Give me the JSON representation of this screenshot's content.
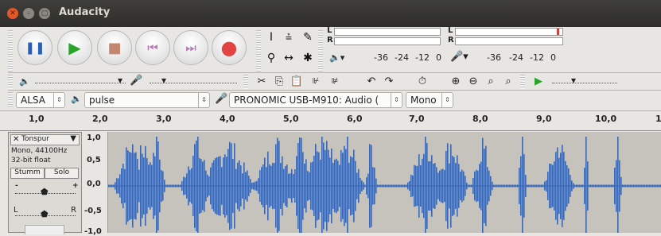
{
  "window": {
    "title": "Audacity"
  },
  "transport": {
    "buttons": [
      "pause",
      "play",
      "stop",
      "skip-start",
      "skip-end",
      "record"
    ]
  },
  "meters": {
    "ticks": [
      "-36",
      "-24",
      "-12",
      "0"
    ],
    "channels": [
      "L",
      "R"
    ]
  },
  "device": {
    "host": "ALSA",
    "output": "pulse",
    "input": "PRONOMIC USB-M910: Audio (",
    "channels": "Mono"
  },
  "ruler": {
    "ticks": [
      "1,0",
      "2,0",
      "3,0",
      "4,0",
      "5,0",
      "6,0",
      "7,0",
      "8,0",
      "9,0",
      "10,0",
      "1"
    ]
  },
  "track": {
    "name": "Tonspur",
    "info1": "Mono, 44100Hz",
    "info2": "32-bit float",
    "mute": "Stumm",
    "solo": "Solo",
    "pan_l": "L",
    "pan_r": "R",
    "gain_minus": "-",
    "gain_plus": "+"
  },
  "vruler": {
    "labels": [
      "1,0",
      "0,5",
      "0,0",
      "-0,5",
      "-1,0"
    ]
  },
  "colors": {
    "waveform": "#3a67b0",
    "close": "#e0673a"
  }
}
